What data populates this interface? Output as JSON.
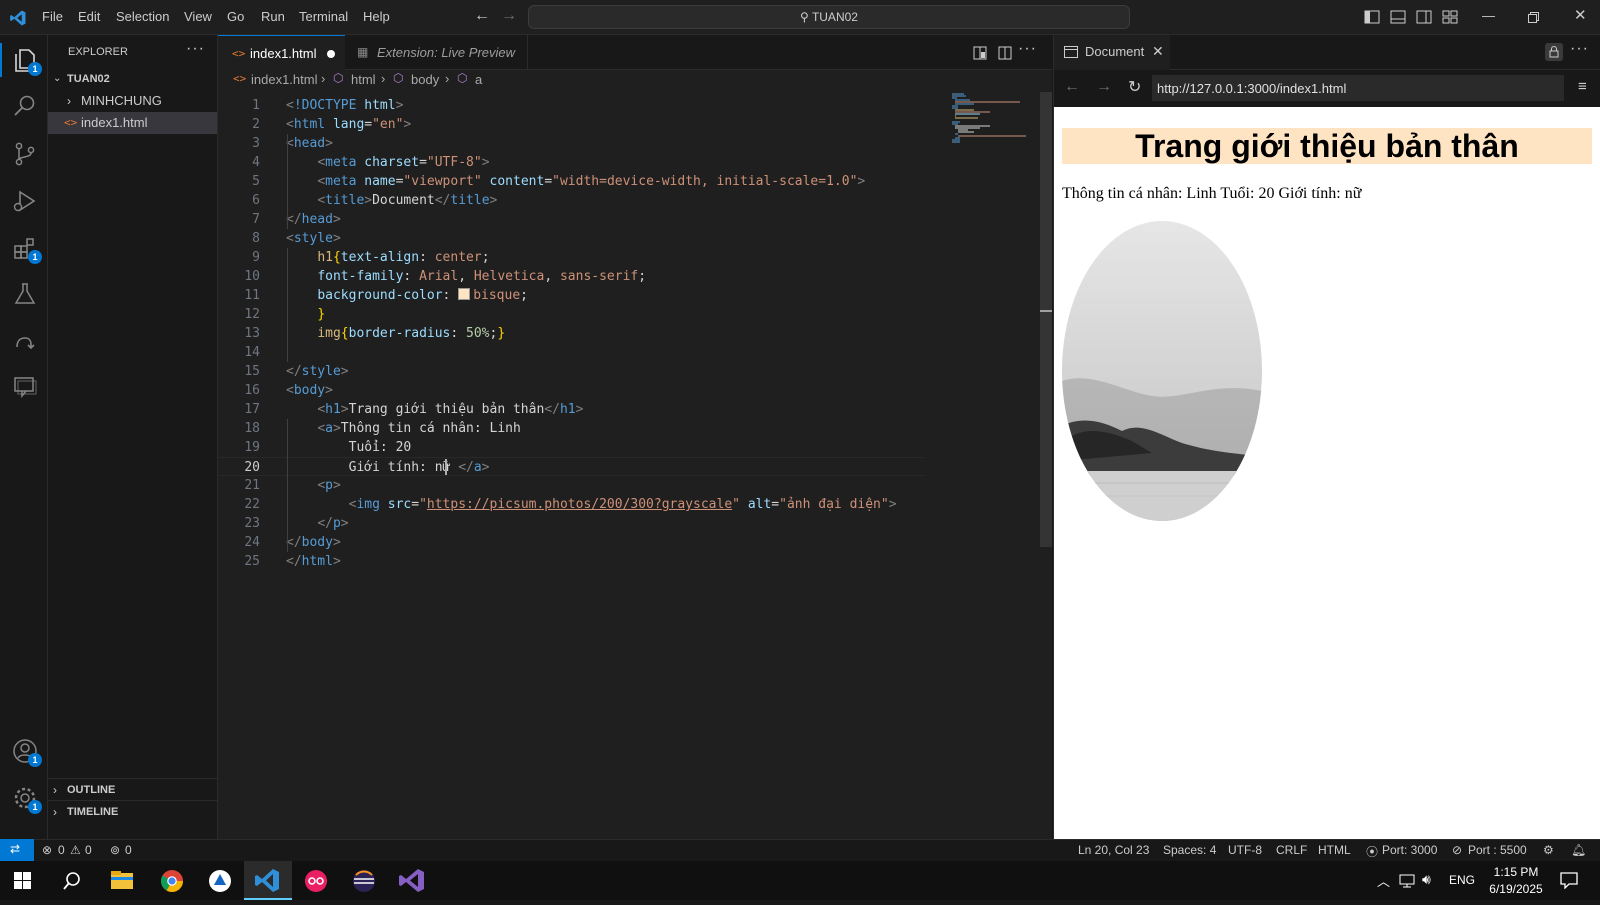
{
  "menu": [
    "File",
    "Edit",
    "Selection",
    "View",
    "Go",
    "Run",
    "Terminal",
    "Help"
  ],
  "command_center": "TUAN02",
  "explorer": {
    "header": "EXPLORER",
    "root": "TUAN02",
    "items": [
      {
        "label": "MINHCHUNG",
        "type": "folder"
      },
      {
        "label": "index1.html",
        "type": "file"
      }
    ],
    "outline": "OUTLINE",
    "timeline": "TIMELINE"
  },
  "badges": {
    "explorer": "1",
    "extensions": "1",
    "accounts": "1",
    "settings": "1"
  },
  "tabs": [
    {
      "label": "index1.html",
      "active": true,
      "modified": true
    },
    {
      "label": "Extension: Live Preview",
      "active": false
    }
  ],
  "breadcrumb": [
    "index1.html",
    "html",
    "body",
    "a"
  ],
  "code": {
    "active_line": 20,
    "lines": [
      "<!DOCTYPE html>",
      "<html lang=\"en\">",
      "<head>",
      "    <meta charset=\"UTF-8\">",
      "    <meta name=\"viewport\" content=\"width=device-width, initial-scale=1.0\">",
      "    <title>Document</title>",
      "</head>",
      "<style>",
      "    h1{text-align: center;",
      "    font-family: Arial, Helvetica, sans-serif;",
      "    background-color: bisque;",
      "    }",
      "    img{border-radius: 50%;}",
      "",
      "</style>",
      "<body>",
      "    <h1>Trang giới thiệu bản thân</h1>",
      "    <a>Thông tin cá nhân: Linh",
      "        Tuổi: 20",
      "        Giới tính: nữ </a>",
      "    <p>",
      "        <img src=\"https://picsum.photos/200/300?grayscale\" alt=\"ảnh đại diện\">",
      "    </p>",
      "</body>",
      "</html>"
    ]
  },
  "preview": {
    "tab": "Document",
    "url": "http://127.0.0.1:3000/index1.html",
    "h1": "Trang giới thiệu bản thân",
    "text": "Thông tin cá nhân: Linh Tuổi: 20 Giới tính: nữ",
    "h1_bg": "#ffe4c4"
  },
  "status": {
    "errors": "0",
    "warnings": "0",
    "ports": "0",
    "position": "Ln 20, Col 23",
    "spaces": "Spaces: 4",
    "encoding": "UTF-8",
    "eol": "CRLF",
    "language": "HTML",
    "port1": "Port: 3000",
    "port2": "Port : 5500"
  },
  "taskbar": {
    "lang": "ENG",
    "time": "1:15 PM",
    "date": "6/19/2025"
  },
  "colors": {
    "accent": "#0078d4",
    "bisque": "#ffe4c4"
  }
}
